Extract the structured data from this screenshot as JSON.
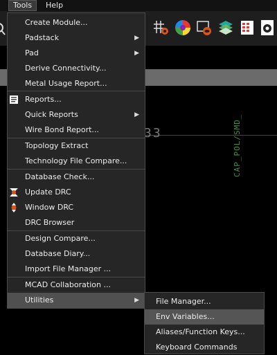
{
  "menubar": {
    "tools": "Tools",
    "help": "Help"
  },
  "canvas": {
    "text": "33",
    "vertical": "CAP_POL/SMD_"
  },
  "menu": {
    "items": [
      {
        "label": "Create Module..."
      },
      {
        "label": "Padstack",
        "arrow": "▶"
      },
      {
        "label": "Pad",
        "arrow": "▶"
      },
      {
        "label": "Derive Connectivity..."
      },
      {
        "label": "Metal Usage Report..."
      },
      {
        "label": "Reports..."
      },
      {
        "label": "Quick Reports",
        "arrow": "▶"
      },
      {
        "label": "Wire Bond Report..."
      },
      {
        "label": "Topology Extract"
      },
      {
        "label": "Technology File Compare..."
      },
      {
        "label": "Database Check..."
      },
      {
        "label": "Update DRC"
      },
      {
        "label": "Window DRC"
      },
      {
        "label": "DRC Browser"
      },
      {
        "label": "Design Compare..."
      },
      {
        "label": "Database Diary..."
      },
      {
        "label": "Import File Manager ..."
      },
      {
        "label": "MCAD Collaboration ..."
      },
      {
        "label": "Utilities",
        "arrow": "▶"
      }
    ]
  },
  "submenu": {
    "items": [
      {
        "label": "File Manager..."
      },
      {
        "label": "Env Variables..."
      },
      {
        "label": "Aliases/Function Keys..."
      },
      {
        "label": "Keyboard Commands"
      }
    ]
  }
}
